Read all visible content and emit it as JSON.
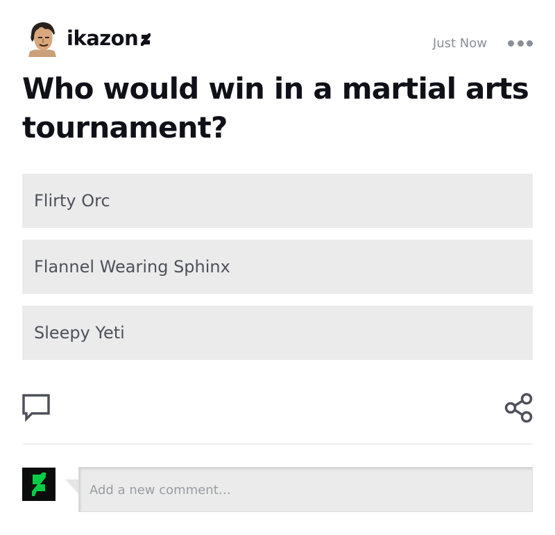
{
  "post": {
    "username": "ikazon",
    "timestamp": "Just Now",
    "title": "Who would win in a martial arts tournament?"
  },
  "poll": {
    "options": [
      {
        "label": "Flirty Orc"
      },
      {
        "label": "Flannel Wearing Sphinx"
      },
      {
        "label": "Sleepy Yeti"
      }
    ]
  },
  "comment": {
    "placeholder": "Add a new comment…"
  },
  "icons": {
    "avatar": "user-avatar",
    "badge": "deviantart-badge-icon",
    "more": "more-icon",
    "comment": "comment-icon",
    "share": "share-icon",
    "logo": "deviantart-logo"
  },
  "colors": {
    "brand": "#05cc47",
    "text": "#101018",
    "muted": "#8a8e96",
    "option_bg": "#ebebeb"
  }
}
